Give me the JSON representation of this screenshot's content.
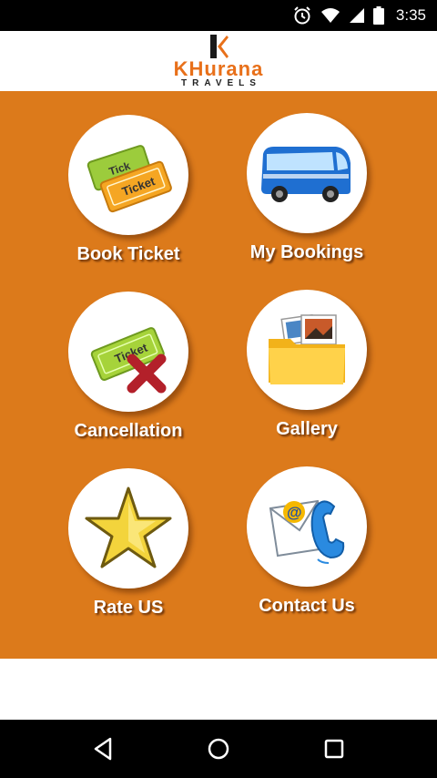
{
  "status_bar": {
    "time": "3:35",
    "icons": [
      "alarm-icon",
      "wifi-icon",
      "signal-icon",
      "battery-icon"
    ]
  },
  "header": {
    "brand_name": "KHurana",
    "brand_sub": "TRAVELS",
    "brand_color": "#e8701a"
  },
  "main": {
    "background_color": "#dc7a1b",
    "tiles": [
      {
        "label": "Book Ticket",
        "icon": "ticket-icon"
      },
      {
        "label": "My Bookings",
        "icon": "bus-icon"
      },
      {
        "label": "Cancellation",
        "icon": "ticket-cancel-icon"
      },
      {
        "label": "Gallery",
        "icon": "folder-photos-icon"
      },
      {
        "label": "Rate US",
        "icon": "star-icon"
      },
      {
        "label": "Contact Us",
        "icon": "contact-envelope-phone-icon"
      }
    ]
  },
  "nav_bar": {
    "buttons": [
      "back-icon",
      "home-icon",
      "recents-icon"
    ]
  }
}
